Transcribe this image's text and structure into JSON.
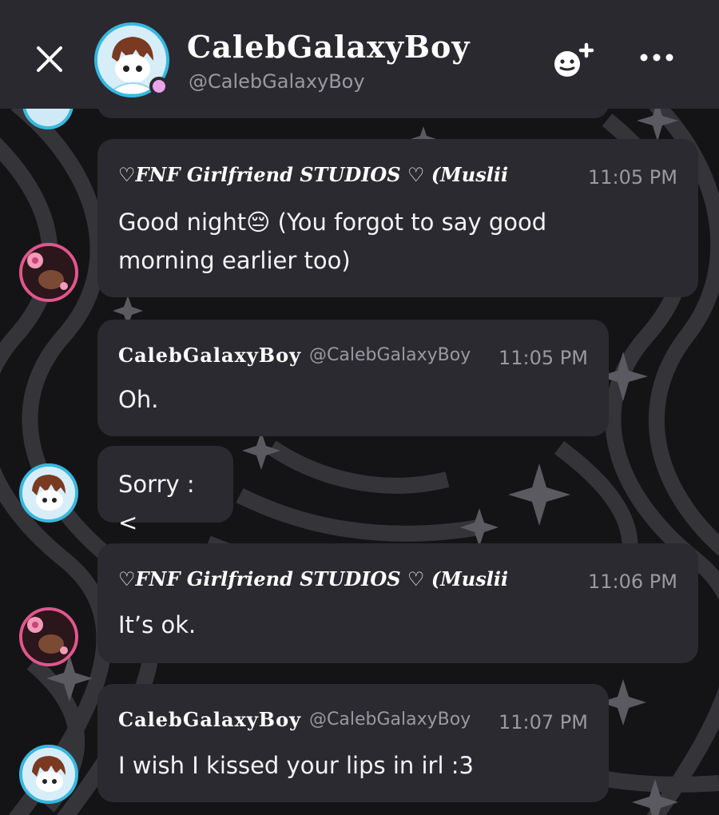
{
  "header": {
    "display_name": "CalebGalaxyBoy",
    "handle": "@CalebGalaxyBoy",
    "status_color": "#e8a6e8",
    "close_icon": "close-icon",
    "add_member_icon": "add-member-icon",
    "more_icon": "more-icon"
  },
  "messages": [
    {
      "sender": "♡FNF Girlfriend STUDIOS ♡ (Muslii",
      "time": "11:05 PM",
      "text_line1": "Good night😔  (You forgot to say good",
      "text_line2": "morning earlier too)"
    },
    {
      "sender": "CalebGalaxyBoy",
      "handle": "@CalebGalaxyBoy",
      "time": "11:05 PM",
      "text": "Oh."
    },
    {
      "text": "Sorry :<"
    },
    {
      "sender": "♡FNF Girlfriend STUDIOS ♡ (Muslii",
      "time": "11:06 PM",
      "text": "It’s ok."
    },
    {
      "sender": "CalebGalaxyBoy",
      "handle": "@CalebGalaxyBoy",
      "time": "11:07 PM",
      "text": "I wish I kissed your lips in irl :3"
    }
  ],
  "colors": {
    "header_bg": "#2a292f",
    "bubble_bg": "#2b2a30",
    "muted_text": "#9a99a0",
    "caleb_ring": "#36b8e0",
    "gf_ring": "#e2568d"
  }
}
